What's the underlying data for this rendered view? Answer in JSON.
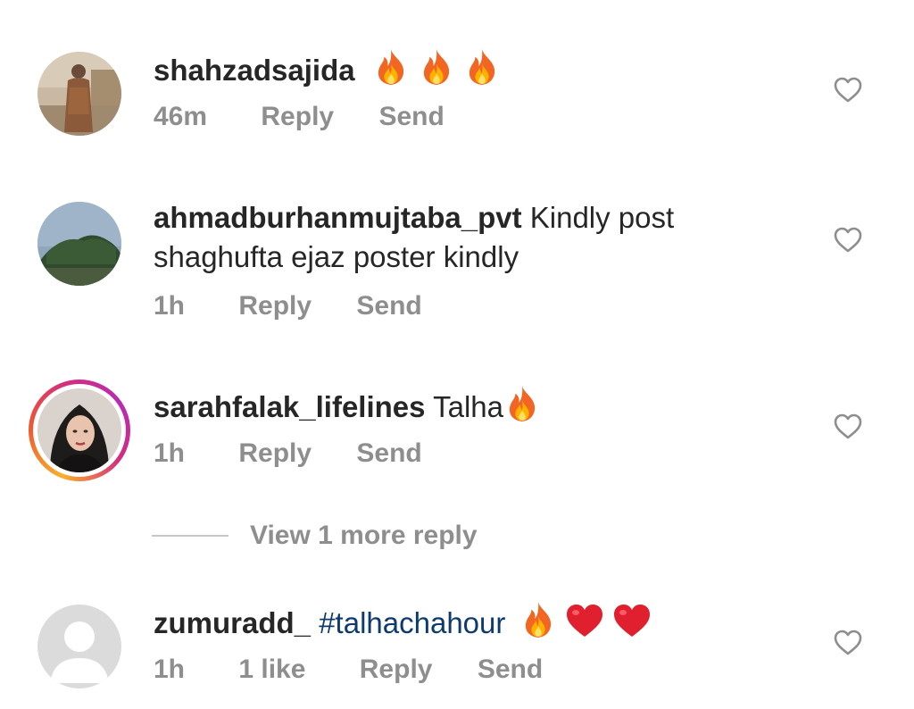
{
  "comments": [
    {
      "username": "shahzadsajida",
      "text": "",
      "emoji_icons": [
        "fire-emoji",
        "fire-emoji",
        "fire-emoji"
      ],
      "time": "46m",
      "reply_label": "Reply",
      "send_label": "Send"
    },
    {
      "username": "ahmadburhanmujtaba_pvt",
      "text": "Kindly post shaghufta ejaz poster kindly",
      "time": "1h",
      "reply_label": "Reply",
      "send_label": "Send"
    },
    {
      "username": "sarahfalak_lifelines",
      "text": "Talha",
      "emoji_icons": [
        "fire-emoji"
      ],
      "time": "1h",
      "reply_label": "Reply",
      "send_label": "Send",
      "has_story_ring": true
    },
    {
      "username": "zumuradd_",
      "hashtag": "#talhachahour",
      "emoji_icons": [
        "fire-emoji",
        "red-heart-emoji",
        "red-heart-emoji"
      ],
      "time": "1h",
      "likes": "1 like",
      "reply_label": "Reply",
      "send_label": "Send"
    }
  ],
  "view_more_replies": "View 1 more reply",
  "colors": {
    "username": "#262626",
    "meta": "#8e8e8e",
    "hashtag": "#0e3b6e",
    "heart_outline": "#8e8e8e"
  }
}
